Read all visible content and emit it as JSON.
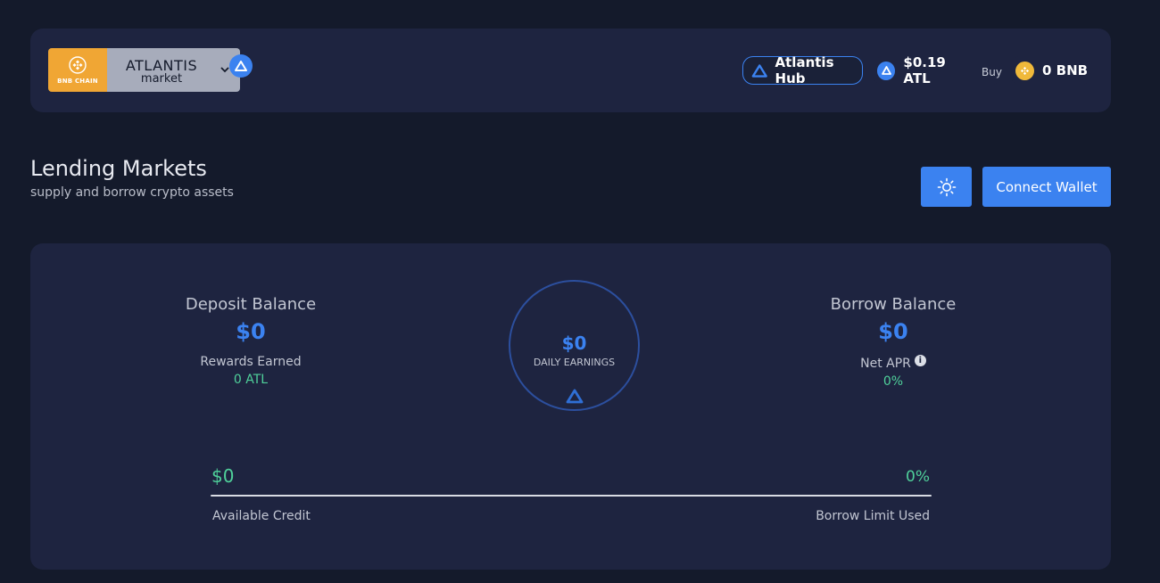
{
  "header": {
    "brand": {
      "chain_label": "BNB CHAIN",
      "title": "ATLANTIS",
      "subtitle": "market",
      "chain_color": "#f0a634"
    },
    "hub_label": "Atlantis Hub",
    "price_label": "$0.19 ATL",
    "buy_label": "Buy",
    "bnb_balance": "0 BNB"
  },
  "page": {
    "title": "Lending Markets",
    "subtitle": "supply and borrow crypto assets",
    "connect_label": "Connect Wallet",
    "theme_icon": "sun-icon"
  },
  "summary": {
    "deposit": {
      "title": "Deposit Balance",
      "value": "$0",
      "rewards_label": "Rewards Earned",
      "rewards_value": "0 ATL"
    },
    "daily": {
      "value": "$0",
      "label": "DAILY EARNINGS"
    },
    "borrow": {
      "title": "Borrow Balance",
      "value": "$0",
      "apr_label": "Net APR",
      "apr_value": "0%"
    },
    "credit": {
      "available_value": "$0",
      "available_label": "Available Credit",
      "limit_value": "0%",
      "limit_label": "Borrow Limit Used",
      "limit_fraction": 0
    }
  },
  "colors": {
    "accent": "#3b82f0",
    "positive": "#4fd09a",
    "background": "#141a2b",
    "panel": "#1e2440"
  }
}
